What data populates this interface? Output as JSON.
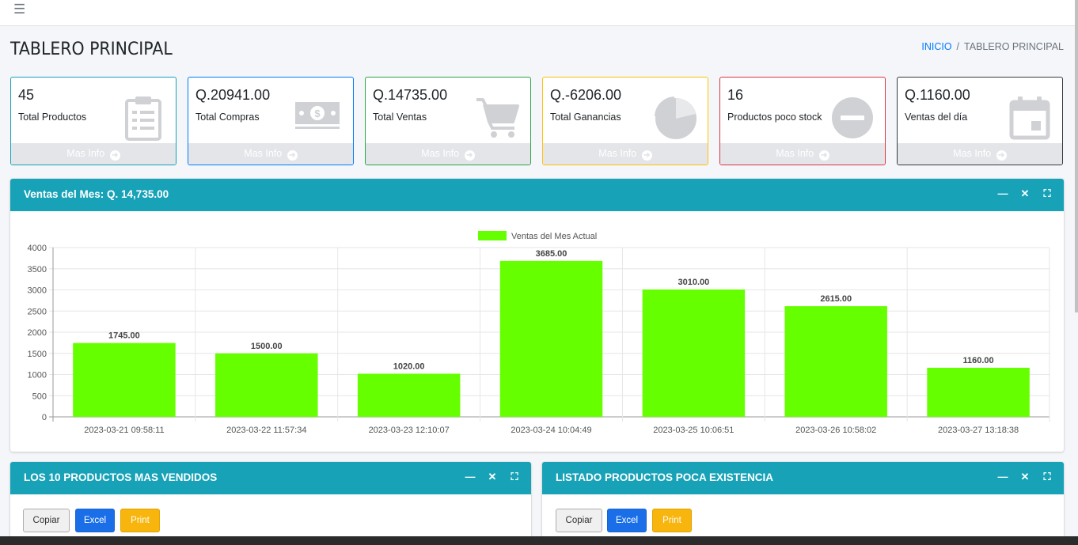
{
  "topbar": {
    "menu_icon": "hamburger-icon"
  },
  "page": {
    "title": "TABLERO PRINCIPAL"
  },
  "breadcrumb": {
    "home": "INICIO",
    "separator": "/",
    "current": "TABLERO PRINCIPAL"
  },
  "cards": [
    {
      "value": "45",
      "label": "Total Productos",
      "footer": "Mas Info",
      "icon": "clipboard-icon",
      "color": "#17a2b8"
    },
    {
      "value": "Q.20941.00",
      "label": "Total Compras",
      "footer": "Mas Info",
      "icon": "money-bill-icon",
      "color": "#007bff"
    },
    {
      "value": "Q.14735.00",
      "label": "Total Ventas",
      "footer": "Mas Info",
      "icon": "shopping-cart-icon",
      "color": "#28a745"
    },
    {
      "value": "Q.-6206.00",
      "label": "Total Ganancias",
      "footer": "Mas Info",
      "icon": "pie-chart-icon",
      "color": "#ffc107"
    },
    {
      "value": "16",
      "label": "Productos poco stock",
      "footer": "Mas Info",
      "icon": "minus-circle-icon",
      "color": "#dc3545"
    },
    {
      "value": "Q.1160.00",
      "label": "Ventas del día",
      "footer": "Mas Info",
      "icon": "calendar-icon",
      "color": "#343a40"
    }
  ],
  "sales_panel": {
    "title": "Ventas del Mes: Q. 14,735.00",
    "tools": [
      "minus-icon",
      "close-icon",
      "expand-icon"
    ]
  },
  "chart_data": {
    "type": "bar",
    "series": [
      {
        "name": "Ventas del Mes Actual",
        "color": "#66ff00",
        "values": [
          1745,
          1500,
          1020,
          3685,
          3010,
          2615,
          1160
        ]
      }
    ],
    "categories": [
      "2023-03-21 09:58:11",
      "2023-03-22 11:57:34",
      "2023-03-23 12:10:07",
      "2023-03-24 10:04:49",
      "2023-03-25 10:06:51",
      "2023-03-26 10:58:02",
      "2023-03-27 13:18:38"
    ],
    "data_labels": [
      "1745.00",
      "1500.00",
      "1020.00",
      "3685.00",
      "3010.00",
      "2615.00",
      "1160.00"
    ],
    "yticks": [
      "0",
      "500",
      "1000",
      "1500",
      "2000",
      "2500",
      "3000",
      "3500",
      "4000"
    ],
    "ylim": [
      0,
      4000
    ],
    "grid": true,
    "legend": "top-center"
  },
  "top_products_panel": {
    "title": "LOS 10 PRODUCTOS MAS VENDIDOS",
    "buttons": {
      "copy": "Copiar",
      "excel": "Excel",
      "print": "Print"
    }
  },
  "low_stock_panel": {
    "title": "LISTADO PRODUCTOS POCA EXISTENCIA",
    "buttons": {
      "copy": "Copiar",
      "excel": "Excel",
      "print": "Print"
    }
  }
}
